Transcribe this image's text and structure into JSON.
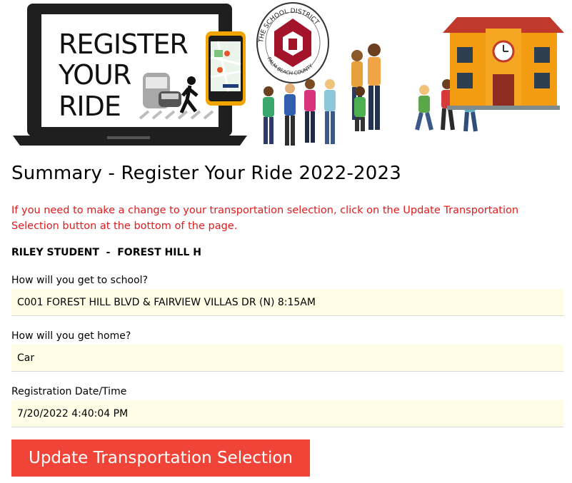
{
  "banner": {
    "laptop_text": [
      "REGISTER",
      "YOUR",
      "RIDE"
    ],
    "seal_text_top": "THE SCHOOL DISTRICT",
    "seal_text_bottom": "PALM BEACH COUNTY"
  },
  "page": {
    "title": "Summary - Register Your Ride 2022-2023",
    "notice": "If you need to make a change to your transportation selection, click on the Update Transportation Selection button at the bottom of the page.",
    "student": "RILEY STUDENT  -  FOREST HILL H"
  },
  "fields": [
    {
      "label": "How will you get to school?",
      "value": "C001 FOREST HILL BLVD & FAIRVIEW VILLAS DR (N) 8:15AM"
    },
    {
      "label": "How will you get home?",
      "value": "Car"
    },
    {
      "label": "Registration Date/Time",
      "value": "7/20/2022 4:40:04 PM"
    }
  ],
  "actions": {
    "update_label": "Update Transportation Selection"
  },
  "colors": {
    "notice": "#e01b1b",
    "button": "#f14438",
    "field_bg": "#fffde6"
  }
}
